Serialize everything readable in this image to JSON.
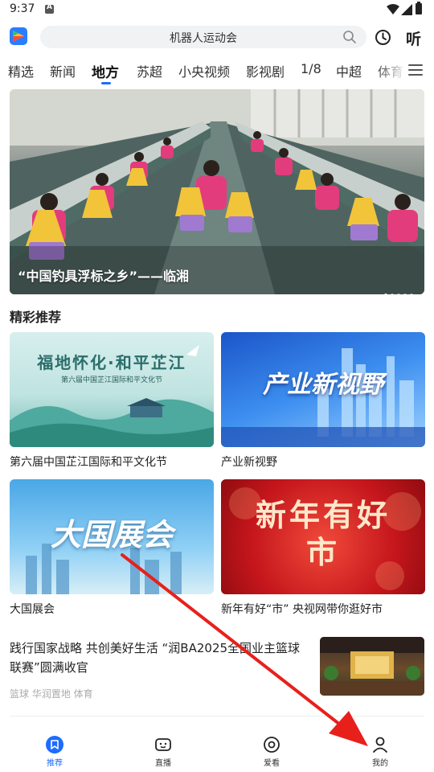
{
  "status_bar": {
    "time": "9:37"
  },
  "search": {
    "query": "机器人运动会",
    "listen_label": "听"
  },
  "tabs": [
    {
      "label": "精选"
    },
    {
      "label": "新闻"
    },
    {
      "label": "地方"
    },
    {
      "label": "苏超"
    },
    {
      "label": "小央视频"
    },
    {
      "label": "影视剧"
    },
    {
      "label": "1/8"
    },
    {
      "label": "中超"
    },
    {
      "label": "体育"
    }
  ],
  "active_tab_index": 2,
  "hero": {
    "caption": "“中国钓具浮标之乡”——临湘"
  },
  "recommend": {
    "title": "精彩推荐",
    "cards": [
      {
        "title": "第六届中国芷江国际和平文化节",
        "img_text": "福地怀化·和平芷江",
        "img_sub": "第六届中国芷江国际和平文化节"
      },
      {
        "title": "产业新视野",
        "img_text": "产业新视野"
      },
      {
        "title": "大国展会",
        "img_text": "大国展会"
      },
      {
        "title": "新年有好“市” 央视网带你逛好市",
        "img_text": "新年有好市"
      }
    ]
  },
  "news": {
    "title": "践行国家战略 共创美好生活 “润BA2025全国业主篮球联赛”圆满收官",
    "meta": "篮球 华润置地 体育"
  },
  "bottom_nav": [
    {
      "label": "推荐",
      "icon": "bookmark-icon"
    },
    {
      "label": "直播",
      "icon": "tv-icon"
    },
    {
      "label": "爱看",
      "icon": "target-icon"
    },
    {
      "label": "我的",
      "icon": "person-icon"
    }
  ],
  "colors": {
    "accent": "#1e6bff",
    "annotation_arrow": "#e8201c"
  }
}
